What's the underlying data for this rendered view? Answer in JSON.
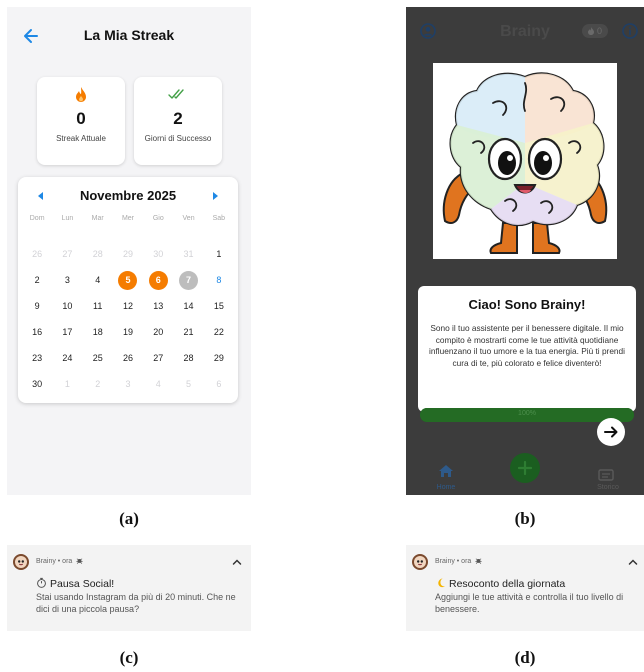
{
  "captions": {
    "a": "(a)",
    "b": "(b)",
    "c": "(c)",
    "d": "(d)"
  },
  "streak_screen": {
    "title": "La Mia Streak",
    "current_streak": {
      "value": "0",
      "label": "Streak Attuale"
    },
    "success_days": {
      "value": "2",
      "label": "Giorni di Successo"
    },
    "calendar": {
      "month": "Novembre 2025",
      "weekdays": [
        "Dom",
        "Lun",
        "Mar",
        "Mer",
        "Gio",
        "Ven",
        "Sab"
      ],
      "days": [
        {
          "t": "26",
          "s": "muted"
        },
        {
          "t": "27",
          "s": "muted"
        },
        {
          "t": "28",
          "s": "muted"
        },
        {
          "t": "29",
          "s": "muted"
        },
        {
          "t": "30",
          "s": "muted"
        },
        {
          "t": "31",
          "s": "muted"
        },
        {
          "t": "1",
          "s": "normal"
        },
        {
          "t": "2",
          "s": "normal"
        },
        {
          "t": "3",
          "s": "normal"
        },
        {
          "t": "4",
          "s": "normal"
        },
        {
          "t": "5",
          "s": "success"
        },
        {
          "t": "6",
          "s": "success"
        },
        {
          "t": "7",
          "s": "grey"
        },
        {
          "t": "8",
          "s": "blue"
        },
        {
          "t": "9",
          "s": "normal"
        },
        {
          "t": "10",
          "s": "normal"
        },
        {
          "t": "11",
          "s": "normal"
        },
        {
          "t": "12",
          "s": "normal"
        },
        {
          "t": "13",
          "s": "normal"
        },
        {
          "t": "14",
          "s": "normal"
        },
        {
          "t": "15",
          "s": "normal"
        },
        {
          "t": "16",
          "s": "normal"
        },
        {
          "t": "17",
          "s": "normal"
        },
        {
          "t": "18",
          "s": "normal"
        },
        {
          "t": "19",
          "s": "normal"
        },
        {
          "t": "20",
          "s": "normal"
        },
        {
          "t": "21",
          "s": "normal"
        },
        {
          "t": "22",
          "s": "normal"
        },
        {
          "t": "23",
          "s": "normal"
        },
        {
          "t": "24",
          "s": "normal"
        },
        {
          "t": "25",
          "s": "normal"
        },
        {
          "t": "26",
          "s": "normal"
        },
        {
          "t": "27",
          "s": "normal"
        },
        {
          "t": "28",
          "s": "normal"
        },
        {
          "t": "29",
          "s": "normal"
        },
        {
          "t": "30",
          "s": "normal"
        },
        {
          "t": "1",
          "s": "muted"
        },
        {
          "t": "2",
          "s": "muted"
        },
        {
          "t": "3",
          "s": "muted"
        },
        {
          "t": "4",
          "s": "muted"
        },
        {
          "t": "5",
          "s": "muted"
        },
        {
          "t": "6",
          "s": "muted"
        }
      ]
    },
    "colors": {
      "accent_blue": "#1e88e5",
      "flame": "#f57c00",
      "check": "#43a047"
    }
  },
  "brainy_screen": {
    "app_title": "Brainy",
    "counter": "0",
    "dialog_title": "Ciao! Sono Brainy!",
    "dialog_text": "Sono il tuo assistente per il benessere digitale. Il mio compito è mostrarti come le tue attività quotidiane influenzano il tuo umore e la tua energia. Più ti prendi cura di te, più colorato e felice diventerò!",
    "progress_percent": 100,
    "progress_label": "100%",
    "nav_home": "Home",
    "nav_history": "Storico",
    "icons": [
      "user-icon",
      "info-icon",
      "home-icon",
      "plus-icon",
      "arrow-right-icon",
      "history-icon"
    ]
  },
  "notification_c": {
    "app": "Brainy • ora",
    "title": "Pausa Social!",
    "body": "Stai usando Instagram da più di 20 minuti. Che ne dici di una piccola pausa?",
    "icon": "stopwatch-icon"
  },
  "notification_d": {
    "app": "Brainy • ora",
    "title": "Resoconto della giornata",
    "body": "Aggiungi le tue attività e controlla il tuo livello di benessere.",
    "icon": "moon-icon"
  }
}
